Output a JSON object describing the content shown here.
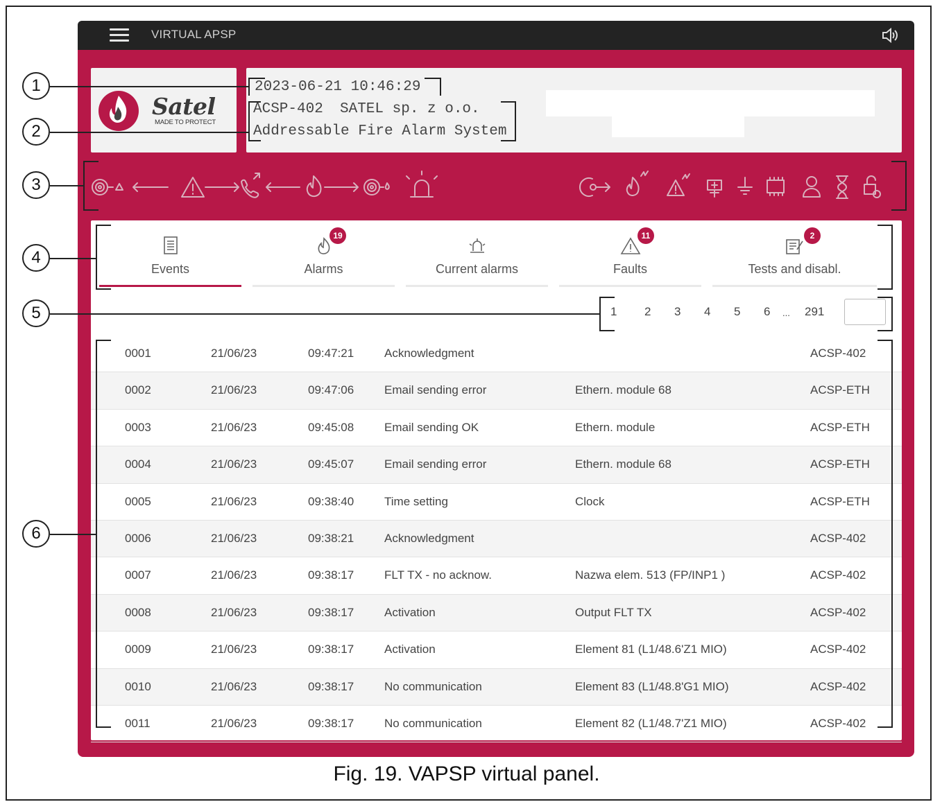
{
  "header": {
    "app_title": "VIRTUAL APSP",
    "menu_icon": "hamburger-menu-icon",
    "sound_icon": "speaker-icon"
  },
  "logo": {
    "brand": "Satel",
    "tagline": "MADE TO PROTECT"
  },
  "panel_info": {
    "datetime": "2023-06-21 10:46:29",
    "model": "ACSP-402",
    "manufacturer": "SATEL sp. z o.o.",
    "system": "Addressable Fire Alarm System"
  },
  "tabs": [
    {
      "label": "Events",
      "icon": "events-list-icon",
      "badge": ""
    },
    {
      "label": "Alarms",
      "icon": "fire-icon",
      "badge": "19"
    },
    {
      "label": "Current alarms",
      "icon": "siren-icon",
      "badge": ""
    },
    {
      "label": "Faults",
      "icon": "warning-icon",
      "badge": "11"
    },
    {
      "label": "Tests and disabl.",
      "icon": "test-disable-icon",
      "badge": "2"
    }
  ],
  "pagination": {
    "pages": [
      "1",
      "2",
      "3",
      "4",
      "5",
      "6"
    ],
    "ellipsis": "...",
    "last": "291",
    "current": "1"
  },
  "events": [
    [
      "0001",
      "21/06/23",
      "09:47:21",
      "Acknowledgment",
      "",
      "ACSP-402"
    ],
    [
      "0002",
      "21/06/23",
      "09:47:06",
      "Email sending error",
      "Ethern. module 68",
      "ACSP-ETH"
    ],
    [
      "0003",
      "21/06/23",
      "09:45:08",
      "Email sending OK",
      "Ethern. module",
      "ACSP-ETH"
    ],
    [
      "0004",
      "21/06/23",
      "09:45:07",
      "Email sending error",
      "Ethern. module 68",
      "ACSP-ETH"
    ],
    [
      "0005",
      "21/06/23",
      "09:38:40",
      "Time setting",
      "Clock",
      "ACSP-ETH"
    ],
    [
      "0006",
      "21/06/23",
      "09:38:21",
      "Acknowledgment",
      "",
      "ACSP-402"
    ],
    [
      "0007",
      "21/06/23",
      "09:38:17",
      "FLT TX - no acknow.",
      "Nazwa elem. 513 (FP/INP1 )",
      "ACSP-402"
    ],
    [
      "0008",
      "21/06/23",
      "09:38:17",
      "Activation",
      "Output FLT TX",
      "ACSP-402"
    ],
    [
      "0009",
      "21/06/23",
      "09:38:17",
      "Activation",
      "Element 81 (L1/48.6'Z1 MIO)",
      "ACSP-402"
    ],
    [
      "0010",
      "21/06/23",
      "09:38:17",
      "No communication",
      "Element 83 (L1/48.8'G1 MIO)",
      "ACSP-402"
    ],
    [
      "0011",
      "21/06/23",
      "09:38:17",
      "No communication",
      "Element 82 (L1/48.7'Z1 MIO)",
      "ACSP-402"
    ]
  ],
  "callouts": [
    "1",
    "2",
    "3",
    "4",
    "5",
    "6"
  ],
  "caption": "Fig. 19. VAPSP virtual panel.",
  "colors": {
    "brand_red": "#b71848",
    "topbar": "#232323",
    "icon_grey": "#c9c9c9"
  }
}
